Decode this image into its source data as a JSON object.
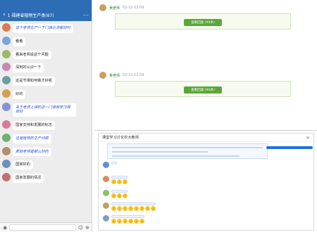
{
  "phone": {
    "status_time": "",
    "status_right": "",
    "title": "1 福建省植物生产类(87)",
    "messages": [
      {
        "sender": "",
        "text": "这个老师生产一下门课必须看好吗",
        "highlight": true,
        "avatar_color": "#d97a54"
      },
      {
        "sender": "",
        "text": "看看",
        "highlight": false,
        "avatar_color": "#7aa7d9"
      },
      {
        "sender": "",
        "text": "看来老师说这个问题",
        "highlight": false,
        "avatar_color": "#9cb86a"
      },
      {
        "sender": "",
        "text": "深刻的认识一下",
        "highlight": false,
        "avatar_color": "#c88ab0"
      },
      {
        "sender": "",
        "text": "这是节课如何做才好呢",
        "highlight": false,
        "avatar_color": "#6aa0a0"
      },
      {
        "sender": "",
        "text": "好的",
        "highlight": false,
        "avatar_color": "#d4a050"
      },
      {
        "sender": "",
        "text": "关于老师上课的这一门课我学习得很好",
        "highlight": true,
        "avatar_color": "#8a8fd9"
      },
      {
        "sender": "",
        "text": "国家支持和发展的标志",
        "highlight": false,
        "avatar_color": "#d97a9c"
      },
      {
        "sender": "",
        "text": "这是植物的生产问题",
        "highlight": true,
        "avatar_color": "#70b070"
      },
      {
        "sender": "",
        "text": "那就老师是那么好的",
        "highlight": true,
        "avatar_color": "#b0906a"
      },
      {
        "sender": "",
        "text": "国家好的",
        "highlight": false,
        "avatar_color": "#6a90c0"
      },
      {
        "sender": "",
        "text": "国家发展的情况",
        "highlight": false,
        "avatar_color": "#c07070"
      }
    ]
  },
  "forum": {
    "posts": [
      {
        "author": "吴老师",
        "time": "02-22 22:09",
        "text": "",
        "reply_head": "",
        "reply_text": "",
        "reply_button": "查看回复 (93条)"
      },
      {
        "author": "吴老师",
        "time": "02-22 22:09",
        "text": "",
        "reply_head": "",
        "reply_text": "",
        "reply_button": "查看回复 (93条)"
      }
    ]
  },
  "live": {
    "header_title": "课堂学习讨论农大教师",
    "close": "×",
    "teacher_text": "",
    "messages": [
      {
        "name": "",
        "text": "",
        "thumbs": 0,
        "avatar_color": "#5b8fd9"
      },
      {
        "name": "",
        "text": "",
        "thumbs": 3,
        "avatar_color": "#d98a5b"
      },
      {
        "name": "",
        "text": "",
        "thumbs": 3,
        "avatar_color": "#8ac06a"
      },
      {
        "name": "",
        "text": "",
        "thumbs": 8,
        "avatar_color": "#c0a05b"
      },
      {
        "name": "",
        "text": "",
        "thumbs": 6,
        "avatar_color": "#7aa0c0"
      }
    ],
    "timestamps": [
      "",
      "",
      ""
    ]
  }
}
